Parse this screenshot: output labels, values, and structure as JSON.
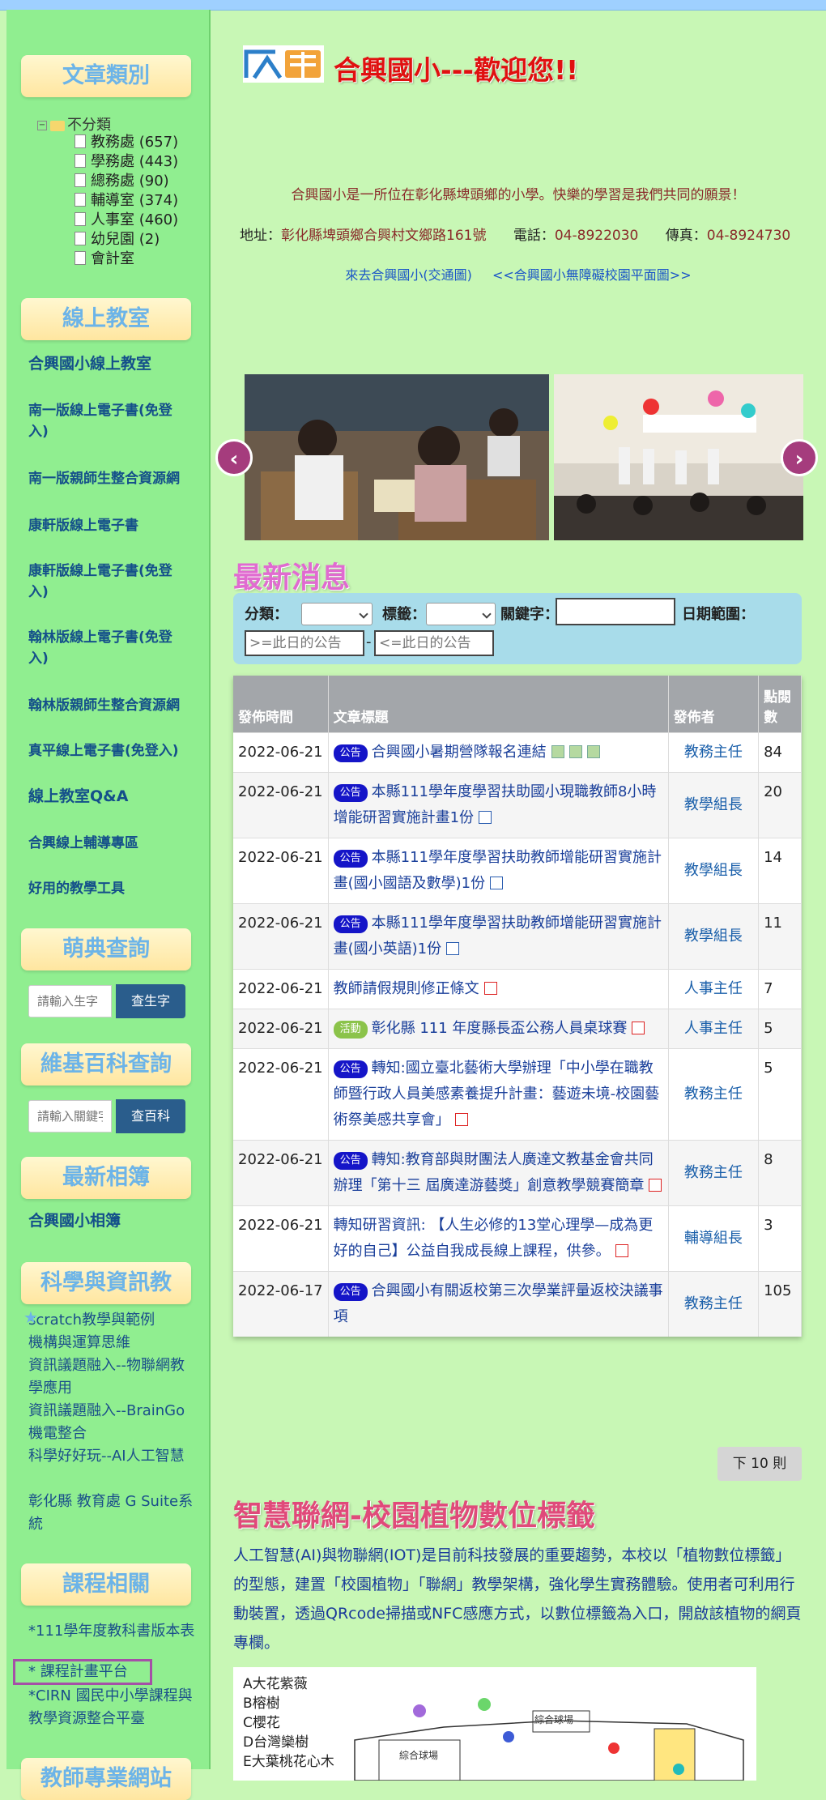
{
  "sidebar": {
    "categories": {
      "title": "文章類別",
      "root": "不分類",
      "items": [
        "教務處 (657)",
        "學務處 (443)",
        "總務處 (90)",
        "輔導室 (374)",
        "人事室 (460)",
        "幼兒園 (2)",
        "會計室"
      ]
    },
    "online": {
      "title": "線上教室",
      "links": [
        "合興國小線上教室",
        "南一版線上電子書(免登入)",
        "南一版親師生整合資源網",
        "康軒版線上電子書",
        "康軒版線上電子書(免登入)",
        "翰林版線上電子書(免登入)",
        "翰林版親師生整合資源網",
        "真平線上電子書(免登入)",
        "線上教室Q&A",
        "合興線上輔導專區",
        "好用的教學工具"
      ]
    },
    "moedict": {
      "title": "萌典查詢",
      "placeholder": "請輸入生字",
      "button": "查生字"
    },
    "wiki": {
      "title": "維基百科查詢",
      "placeholder": "請輸入關鍵字",
      "button": "查百科"
    },
    "album": {
      "title": "最新相簿",
      "link": "合興國小相簿"
    },
    "science": {
      "title": "科學與資訊教",
      "links": [
        "scratch教學與範例",
        "機構與運算思維",
        "資訊議題融入--物聯網教學應用",
        "資訊議題融入--BrainGo機電整合",
        "科學好好玩--AI人工智慧",
        "彰化縣 教育處 G Suite系統"
      ]
    },
    "courses": {
      "title": "課程相關",
      "links": [
        "*111學年度教科書版本表",
        "* 課程計畫平台",
        "*CIRN 國民中小學課程與教學資源整合平臺"
      ]
    },
    "partial_title": "教師專業網站"
  },
  "header": {
    "logo_text": "合興",
    "welcome": "合興國小---歡迎您!!",
    "intro": "合興國小是一所位在彰化縣埤頭鄉的小學。快樂的學習是我們共同的願景！",
    "address_label": "地址：",
    "address": "彰化縣埤頭鄉合興村文鄉路161號",
    "phone_label": "電話：",
    "phone": "04-8922030",
    "fax_label": "傳真：",
    "fax": "04-8924730",
    "link_traffic": "來去合興國小(交通圖)",
    "link_map": "<<合興國小無障礙校園平面圖>>"
  },
  "news": {
    "title": "最新消息",
    "filter": {
      "category_label": "分類：",
      "tag_label": "標籤：",
      "keyword_label": "關鍵字：",
      "date_label": "日期範圍：",
      "from_placeholder": ">=此日的公告",
      "to_placeholder": "<=此日的公告",
      "dash": "-"
    },
    "columns": [
      "發佈時間",
      "文章標題",
      "發佈者",
      "點閱數"
    ],
    "rows": [
      {
        "date": "2022-06-21",
        "badge": "公告",
        "title": "合興國小暑期營隊報名連結",
        "icons": [
          "img",
          "img",
          "img"
        ],
        "publisher": "教務主任",
        "hits": "84"
      },
      {
        "date": "2022-06-21",
        "badge": "公告",
        "title": "本縣111學年度學習扶助國小現職教師8小時增能研習實施計畫1份",
        "icons": [
          "word"
        ],
        "publisher": "教學組長",
        "hits": "20"
      },
      {
        "date": "2022-06-21",
        "badge": "公告",
        "title": "本縣111學年度學習扶助教師增能研習實施計畫(國小國語及數學)1份",
        "icons": [
          "word"
        ],
        "publisher": "教學組長",
        "hits": "14"
      },
      {
        "date": "2022-06-21",
        "badge": "公告",
        "title": "本縣111學年度學習扶助教師增能研習實施計畫(國小英語)1份",
        "icons": [
          "word"
        ],
        "publisher": "教學組長",
        "hits": "11"
      },
      {
        "date": "2022-06-21",
        "badge": "",
        "title": "教師請假規則修正條文",
        "icons": [
          "pdf"
        ],
        "publisher": "人事主任",
        "hits": "7"
      },
      {
        "date": "2022-06-21",
        "badge": "活動",
        "title": "彰化縣 111 年度縣長盃公務人員桌球賽",
        "icons": [
          "pdf"
        ],
        "publisher": "人事主任",
        "hits": "5"
      },
      {
        "date": "2022-06-21",
        "badge": "公告",
        "title": "轉知:國立臺北藝術大學辦理「中小學在職教師暨行政人員美感素養提升計畫：藝遊未境-校園藝術祭美感共享會」",
        "icons": [
          "pdf"
        ],
        "publisher": "教務主任",
        "hits": "5"
      },
      {
        "date": "2022-06-21",
        "badge": "公告",
        "title": "轉知:教育部與財團法人廣達文教基金會共同辦理「第十三 屆廣達游藝獎」創意教學競賽簡章",
        "icons": [
          "pdf"
        ],
        "publisher": "教務主任",
        "hits": "8"
      },
      {
        "date": "2022-06-21",
        "badge": "",
        "title": "轉知研習資訊: 【人生必修的13堂心理學—成為更好的自己】公益自我成長線上課程，供參。",
        "icons": [
          "pdf"
        ],
        "publisher": "輔導組長",
        "hits": "3"
      },
      {
        "date": "2022-06-17",
        "badge": "公告",
        "title": "合興國小有關返校第三次學業評量返校決議事項",
        "icons": [],
        "publisher": "教務主任",
        "hits": "105"
      }
    ],
    "next_button": "下 10 則"
  },
  "iot": {
    "title": "智慧聯網-校園植物數位標籤",
    "paragraph": "人工智慧(AI)與物聯網(IOT)是目前科技發展的重要趨勢，本校以「植物數位標籤」的型態，建置「校園植物」「聯網」教學架構，強化學生實務體驗。使用者可利用行動裝置，透過QRcode掃描或NFC感應方式，以數位標籤為入口，開啟該植物的網頁專欄。",
    "map_labels": [
      "A大花紫薇",
      "B榕樹",
      "C櫻花",
      "D台灣欒樹",
      "E大葉桃花心木"
    ],
    "map_areas": [
      "綜合球場",
      "綜合球場"
    ]
  }
}
